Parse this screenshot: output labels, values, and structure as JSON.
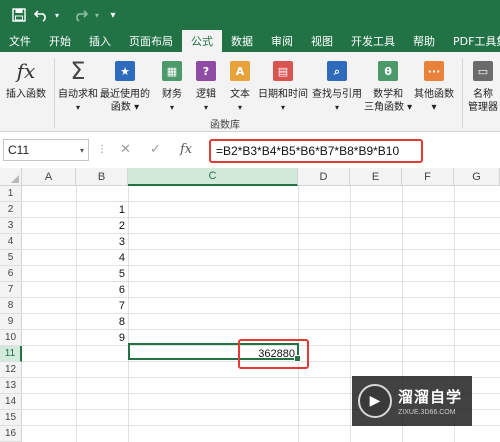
{
  "quick_access": {
    "save_icon": "save-icon",
    "undo_icon": "undo-icon",
    "redo_icon": "redo-icon"
  },
  "tabs": [
    {
      "label": "文件",
      "active": false
    },
    {
      "label": "开始",
      "active": false
    },
    {
      "label": "插入",
      "active": false
    },
    {
      "label": "页面布局",
      "active": false
    },
    {
      "label": "公式",
      "active": true
    },
    {
      "label": "数据",
      "active": false
    },
    {
      "label": "审阅",
      "active": false
    },
    {
      "label": "视图",
      "active": false
    },
    {
      "label": "开发工具",
      "active": false
    },
    {
      "label": "帮助",
      "active": false
    },
    {
      "label": "PDF工具集",
      "active": false
    }
  ],
  "ribbon": {
    "insert_function": "插入函数",
    "autosum_line1": "自动求和",
    "autosum_line2": "",
    "recent_line1": "最近使用的",
    "recent_line2": "函数 ▾",
    "financial": "财务",
    "logical": "逻辑",
    "text": "文本",
    "datetime": "日期和时间",
    "lookup": "查找与引用",
    "math_line1": "数学和",
    "math_line2": "三角函数 ▾",
    "other_line1": "其他函数",
    "other_line2": "▾",
    "name_manager_line1": "名称",
    "name_manager_line2": "管理器",
    "group_label": "函数库",
    "accent": "#217346"
  },
  "formula_bar": {
    "name_box": "C11",
    "fx": "fx",
    "formula": "=B2*B3*B4*B5*B6*B7*B8*B9*B10"
  },
  "sheet": {
    "columns": [
      "A",
      "B",
      "C",
      "D",
      "E",
      "F",
      "G"
    ],
    "rows": [
      "1",
      "2",
      "3",
      "4",
      "5",
      "6",
      "7",
      "8",
      "9",
      "10",
      "11",
      "12",
      "13",
      "14",
      "15",
      "16"
    ],
    "column_b_values": [
      "1",
      "2",
      "3",
      "4",
      "5",
      "6",
      "7",
      "8",
      "9"
    ],
    "c11_value": "362880",
    "active_cell": "C11"
  },
  "watermark": {
    "main": "溜溜自学",
    "sub": "ZIXUE.3D66.COM"
  }
}
